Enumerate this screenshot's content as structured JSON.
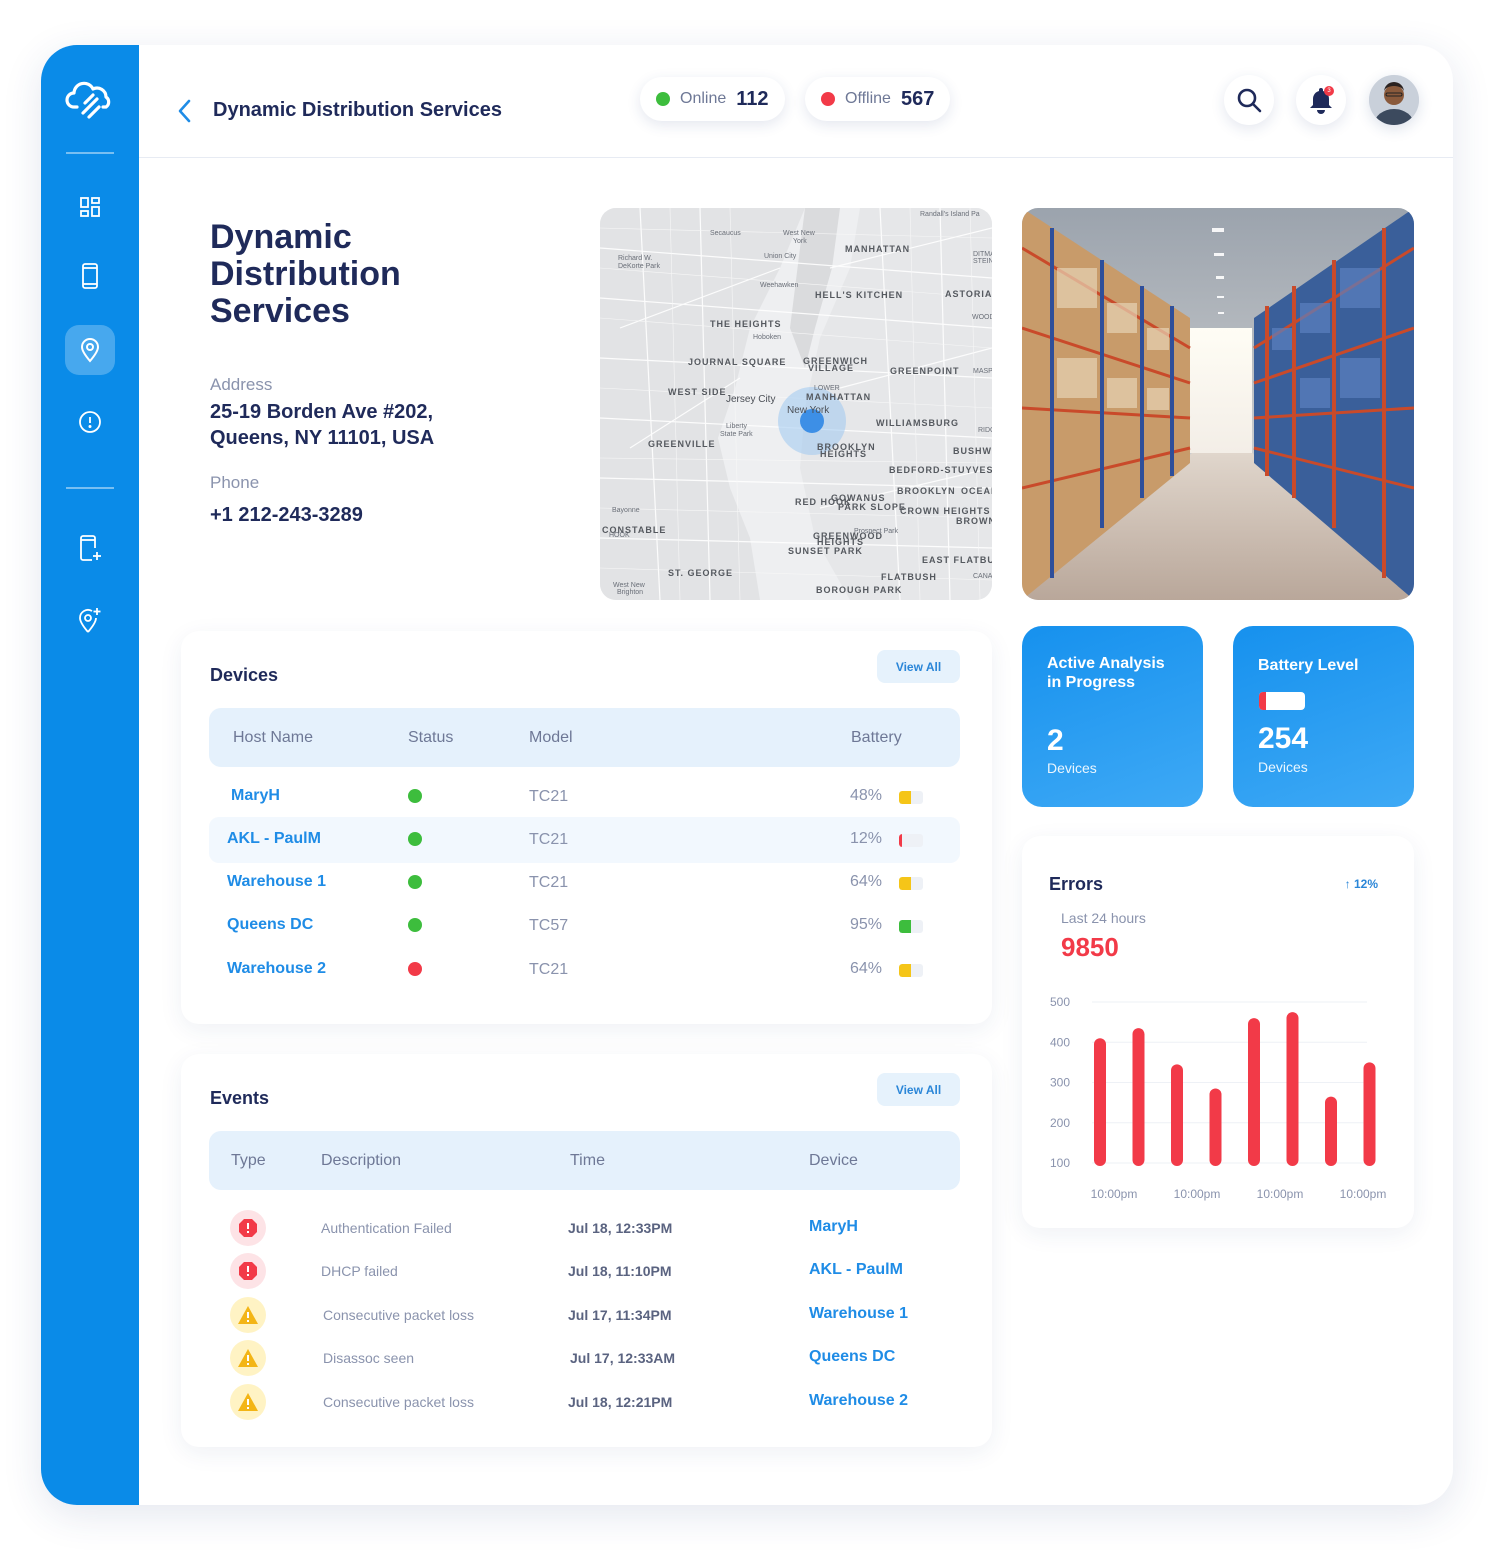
{
  "topbar": {
    "title": "Dynamic Distribution Services",
    "online": {
      "label": "Online",
      "value": "112",
      "color": "#3dbd3d"
    },
    "offline": {
      "label": "Offline",
      "value": "567",
      "color": "#f23a48"
    },
    "notification_count": "3"
  },
  "sidebar": {
    "items": [
      {
        "icon": "dashboard-icon"
      },
      {
        "icon": "device-icon"
      },
      {
        "icon": "location-pin-icon",
        "active": true
      },
      {
        "icon": "alert-icon"
      },
      {
        "icon": "add-device-icon"
      },
      {
        "icon": "add-location-icon"
      }
    ]
  },
  "site": {
    "name": "Dynamic Distribution Services",
    "address_label": "Address",
    "address_line1": "25-19 Borden Ave #202,",
    "address_line2": "Queens, NY 11101, USA",
    "phone_label": "Phone",
    "phone": "+1 212-243-3289"
  },
  "map": {
    "labels": [
      {
        "text": "Randall's Island Pa"
      },
      {
        "text": "Secaucus"
      },
      {
        "text": "West New"
      },
      {
        "text": "York"
      },
      {
        "text": "MANHATTAN"
      },
      {
        "text": "Richard W."
      },
      {
        "text": "DeKorte Park"
      },
      {
        "text": "Union City"
      },
      {
        "text": "Weehawken"
      },
      {
        "text": "HELL'S KITCHEN"
      },
      {
        "text": "ASTORIA"
      },
      {
        "text": "THE HEIGHTS"
      },
      {
        "text": "Hoboken"
      },
      {
        "text": "JOURNAL SQUARE"
      },
      {
        "text": "GREENWICH"
      },
      {
        "text": "VILLAGE"
      },
      {
        "text": "GREENPOINT"
      },
      {
        "text": "WEST SIDE"
      },
      {
        "text": "Jersey City"
      },
      {
        "text": "LOWER"
      },
      {
        "text": "MANHATTAN"
      },
      {
        "text": "New York"
      },
      {
        "text": "WILLIAMSBURG"
      },
      {
        "text": "Liberty"
      },
      {
        "text": "State Park"
      },
      {
        "text": "GREENVILLE"
      },
      {
        "text": "BROOKLYN"
      },
      {
        "text": "HEIGHTS"
      },
      {
        "text": "BUSHWICK"
      },
      {
        "text": "BEDFORD-STUYVESANT"
      },
      {
        "text": "BROOKLYN"
      },
      {
        "text": "OCEAN HI"
      },
      {
        "text": "RED HOOK"
      },
      {
        "text": "GOWANUS"
      },
      {
        "text": "PARK SLOPE"
      },
      {
        "text": "CROWN HEIGHTS"
      },
      {
        "text": "BROWNSVIL"
      },
      {
        "text": "Bayonne"
      },
      {
        "text": "CONSTABLE"
      },
      {
        "text": "HOOK"
      },
      {
        "text": "GREENWOOD"
      },
      {
        "text": "HEIGHTS"
      },
      {
        "text": "Prospect Park"
      },
      {
        "text": "SUNSET PARK"
      },
      {
        "text": "EAST FLATBUSH"
      },
      {
        "text": "ST. GEORGE"
      },
      {
        "text": "FLATBUSH"
      },
      {
        "text": "CANAR"
      },
      {
        "text": "West New"
      },
      {
        "text": "Brighton"
      },
      {
        "text": "BOROUGH PARK"
      },
      {
        "text": "MASPE"
      },
      {
        "text": "WOODS"
      },
      {
        "text": "RIDG"
      },
      {
        "text": "DITMA"
      },
      {
        "text": "STEIN"
      }
    ]
  },
  "devices": {
    "title": "Devices",
    "view_all": "View All",
    "columns": [
      "Host Name",
      "Status",
      "Model",
      "Battery"
    ],
    "rows": [
      {
        "host": "MaryH",
        "status": "online",
        "model": "TC21",
        "battery": "48%",
        "level": 0.48,
        "color": "#f5c518"
      },
      {
        "host": "AKL - PaulM",
        "status": "online",
        "model": "TC21",
        "battery": "12%",
        "level": 0.12,
        "color": "#f23a48"
      },
      {
        "host": "Warehouse 1",
        "status": "online",
        "model": "TC21",
        "battery": "64%",
        "level": 0.48,
        "color": "#f5c518"
      },
      {
        "host": "Queens DC",
        "status": "online",
        "model": "TC57",
        "battery": "95%",
        "level": 0.48,
        "color": "#3dbd3d"
      },
      {
        "host": "Warehouse 2",
        "status": "offline",
        "model": "TC21",
        "battery": "64%",
        "level": 0.48,
        "color": "#f5c518"
      }
    ]
  },
  "events": {
    "title": "Events",
    "view_all": "View All",
    "columns": [
      "Type",
      "Description",
      "Time",
      "Device"
    ],
    "rows": [
      {
        "type": "error",
        "description": "Authentication Failed",
        "time": "Jul 18, 12:33PM",
        "device": "MaryH"
      },
      {
        "type": "error",
        "description": "DHCP failed",
        "time": "Jul 18, 11:10PM",
        "device": "AKL - PaulM"
      },
      {
        "type": "warning",
        "description": "Consecutive packet loss",
        "time": "Jul 17, 11:34PM",
        "device": "Warehouse 1"
      },
      {
        "type": "warning",
        "description": "Disassoc seen",
        "time": "Jul 17, 12:33AM",
        "device": "Queens DC"
      },
      {
        "type": "warning",
        "description": "Consecutive packet loss",
        "time": "Jul 18, 12:21PM",
        "device": "Warehouse 2"
      }
    ]
  },
  "stats": {
    "analysis": {
      "title_line1": "Active Analysis",
      "title_line2": "in Progress",
      "value": "2",
      "unit": "Devices"
    },
    "battery": {
      "title": "Battery Level",
      "value": "254",
      "unit": "Devices",
      "level": 0.15
    }
  },
  "errors": {
    "title": "Errors",
    "trend": "↑ 12%",
    "period": "Last 24 hours",
    "total": "9850",
    "chart_data": {
      "type": "bar",
      "title": "Errors",
      "ylim": [
        100,
        500
      ],
      "yticks": [
        "500",
        "400",
        "300",
        "200",
        "100"
      ],
      "xticks": [
        "10:00pm",
        "10:00pm",
        "10:00pm",
        "10:00pm"
      ],
      "values": [
        410,
        435,
        345,
        285,
        460,
        475,
        265,
        350
      ],
      "color": "#f23a48",
      "grid": true
    }
  }
}
